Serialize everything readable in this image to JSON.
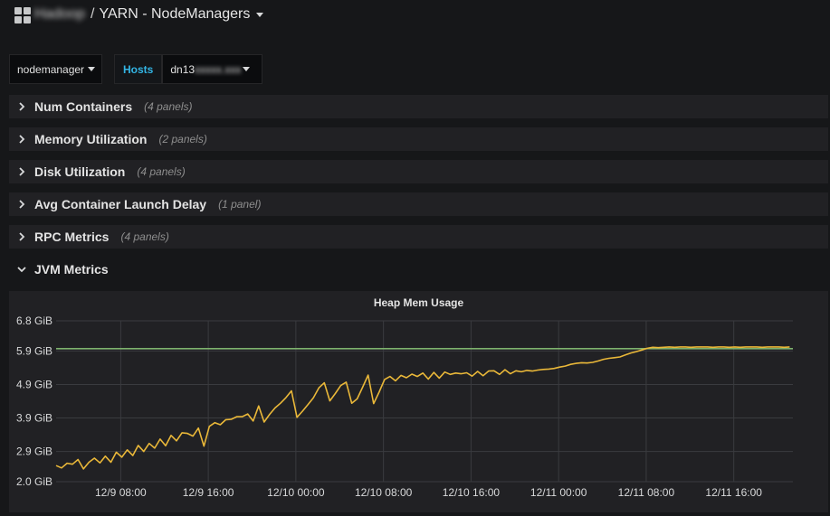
{
  "header": {
    "folder": "Hadoop",
    "separator": "/",
    "title": "YARN - NodeManagers"
  },
  "variables": {
    "job_value": "nodemanager",
    "hosts_label": "Hosts",
    "hosts_value_prefix": "dn13",
    "hosts_value_blurred": "xxxxx.xxx"
  },
  "rows": [
    {
      "title": "Num Containers",
      "count": "(4 panels)"
    },
    {
      "title": "Memory Utilization",
      "count": "(2 panels)"
    },
    {
      "title": "Disk Utilization",
      "count": "(4 panels)"
    },
    {
      "title": "Avg Container Launch Delay",
      "count": "(1 panel)"
    },
    {
      "title": "RPC Metrics",
      "count": "(4 panels)"
    },
    {
      "title": "JVM Metrics",
      "count": ""
    }
  ],
  "colors": {
    "background": "#161719",
    "panel": "#212124",
    "series_heap_used": "#eab839",
    "series_heap_max": "#7eb26d",
    "accent_link": "#33b5e5"
  },
  "chart_data": {
    "type": "line",
    "title": "Heap Mem Usage",
    "ylabel": "",
    "xlabel": "",
    "y_ticks": [
      "6.8 GiB",
      "5.9 GiB",
      "4.9 GiB",
      "3.9 GiB",
      "2.9 GiB",
      "2.0 GiB"
    ],
    "y_tick_values": [
      6.8,
      5.9,
      4.9,
      3.9,
      2.9,
      2.0
    ],
    "ylim": [
      2.0,
      6.8
    ],
    "x_ticks": [
      "12/9 08:00",
      "12/9 16:00",
      "12/10 00:00",
      "12/10 08:00",
      "12/10 16:00",
      "12/11 00:00",
      "12/11 08:00",
      "12/11 16:00"
    ],
    "x_tick_hours": [
      8,
      16,
      24,
      32,
      40,
      48,
      56,
      64
    ],
    "xlim_hours": [
      2.1,
      69.4
    ],
    "grid": true,
    "legend": "none",
    "series": [
      {
        "color": "#7eb26d",
        "x_hours": [
          2.1,
          69.4
        ],
        "values": [
          5.97,
          5.97
        ]
      },
      {
        "color": "#eab839",
        "x_hours": [
          2.1,
          2.6,
          3.1,
          3.6,
          4.1,
          4.6,
          5.1,
          5.6,
          6.1,
          6.6,
          7.1,
          7.6,
          8.1,
          8.6,
          9.1,
          9.6,
          10.1,
          10.6,
          11.1,
          11.6,
          12.1,
          12.6,
          13.1,
          13.6,
          14.1,
          14.6,
          15.1,
          15.6,
          16.1,
          16.6,
          17.1,
          17.6,
          18.1,
          18.6,
          19.1,
          19.6,
          20.1,
          20.6,
          21.1,
          21.6,
          22.1,
          22.6,
          23.1,
          23.6,
          24.1,
          24.6,
          25.1,
          25.6,
          26.1,
          26.6,
          27.1,
          27.6,
          28.1,
          28.6,
          29.1,
          29.6,
          30.1,
          30.6,
          31.1,
          31.6,
          32.1,
          32.6,
          33.1,
          33.6,
          34.1,
          34.6,
          35.1,
          35.6,
          36.1,
          36.6,
          37.1,
          37.6,
          38.1,
          38.6,
          39.1,
          39.6,
          40.1,
          40.6,
          41.1,
          41.6,
          42.1,
          42.6,
          43.1,
          43.6,
          44.1,
          44.6,
          45.1,
          45.6,
          46.1,
          46.6,
          47.1,
          47.6,
          48.1,
          48.6,
          49.1,
          49.6,
          50.1,
          50.6,
          51.1,
          51.6,
          52.1,
          52.6,
          53.1,
          53.6,
          54.1,
          54.6,
          55.1,
          55.6,
          56.1,
          56.6,
          57.1,
          57.6,
          58.1,
          58.6,
          59.1,
          59.6,
          60.1,
          60.6,
          61.1,
          61.6,
          62.1,
          62.6,
          63.1,
          63.6,
          64.1,
          64.6,
          65.1,
          65.6,
          66.1,
          66.6,
          67.1,
          67.6,
          68.1,
          68.6,
          69.1,
          69.4
        ],
        "values": [
          2.48,
          2.41,
          2.55,
          2.52,
          2.66,
          2.38,
          2.58,
          2.7,
          2.56,
          2.76,
          2.58,
          2.88,
          2.73,
          2.95,
          2.78,
          3.08,
          2.9,
          3.14,
          3.0,
          3.27,
          3.07,
          3.38,
          3.22,
          3.46,
          3.44,
          3.36,
          3.6,
          3.06,
          3.65,
          3.76,
          3.7,
          3.85,
          3.86,
          3.94,
          3.94,
          4.02,
          3.81,
          4.26,
          3.78,
          4.01,
          4.2,
          4.34,
          4.51,
          4.71,
          3.92,
          4.1,
          4.3,
          4.5,
          4.8,
          4.95,
          4.41,
          4.63,
          4.87,
          4.97,
          4.34,
          4.47,
          4.82,
          5.18,
          4.33,
          4.67,
          5.05,
          5.14,
          5.01,
          5.17,
          5.1,
          5.21,
          5.14,
          5.24,
          5.06,
          5.26,
          5.09,
          5.27,
          5.2,
          5.24,
          5.22,
          5.25,
          5.15,
          5.29,
          5.16,
          5.3,
          5.31,
          5.2,
          5.34,
          5.22,
          5.31,
          5.28,
          5.32,
          5.3,
          5.33,
          5.35,
          5.36,
          5.38,
          5.42,
          5.45,
          5.5,
          5.53,
          5.55,
          5.54,
          5.56,
          5.6,
          5.65,
          5.68,
          5.7,
          5.72,
          5.78,
          5.84,
          5.88,
          5.93,
          5.98,
          6.01,
          6.0,
          6.01,
          6.02,
          6.01,
          6.02,
          6.02,
          6.01,
          6.02,
          6.02,
          6.02,
          6.01,
          6.02,
          6.02,
          6.01,
          6.02,
          6.01,
          6.02,
          6.02,
          6.02,
          6.01,
          6.02,
          6.02,
          6.02,
          6.01,
          6.02
        ]
      }
    ]
  }
}
